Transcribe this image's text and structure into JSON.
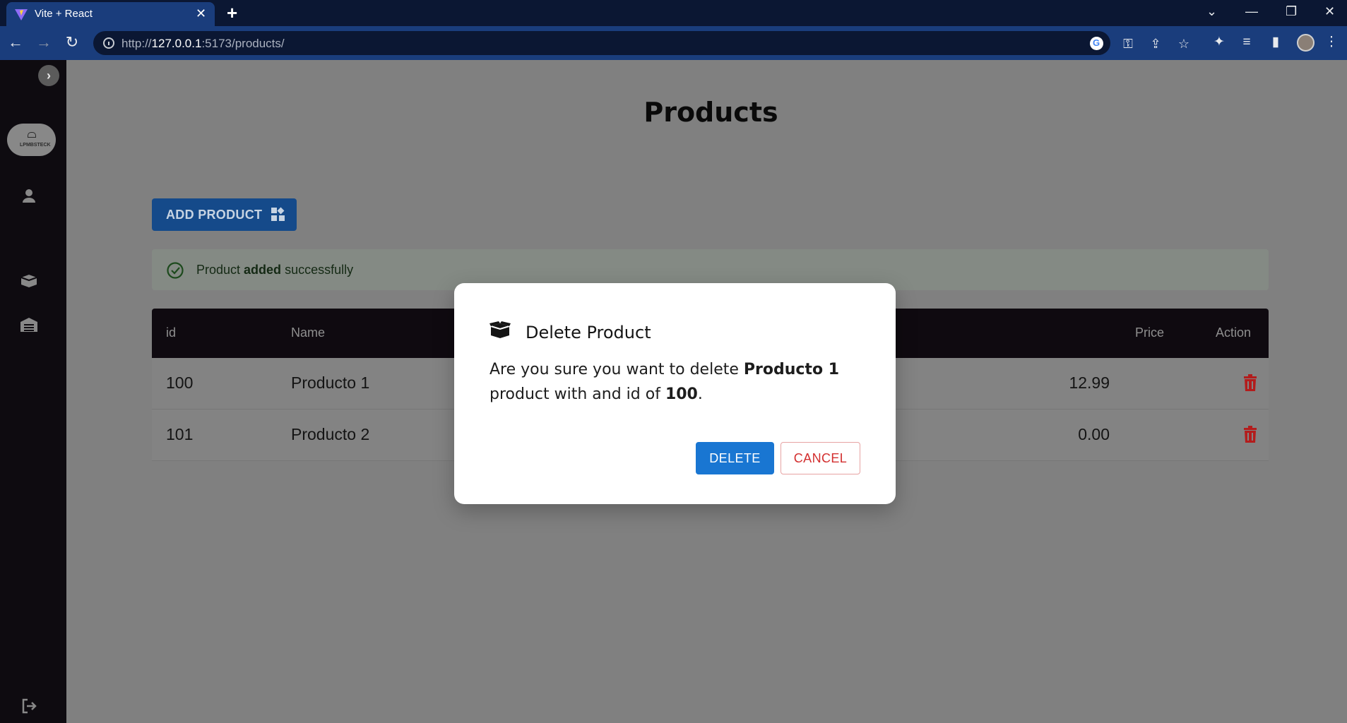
{
  "browser": {
    "tab_title": "Vite + React",
    "new_tab": "+",
    "url_scheme": "http://",
    "url_host": "127.0.0.1",
    "url_path": ":5173/products/"
  },
  "sidebar": {
    "logo_text": "LPMBSTECK",
    "items": [
      {
        "icon": "user-icon"
      },
      {
        "icon": "box-icon"
      },
      {
        "icon": "warehouse-icon"
      },
      {
        "icon": "logout-icon"
      }
    ]
  },
  "page": {
    "title": "Products",
    "add_button_label": "ADD PRODUCT",
    "alert": {
      "prefix": "Product ",
      "bold": "added",
      "suffix": " successfully"
    }
  },
  "table": {
    "headers": {
      "id": "id",
      "name": "Name",
      "price": "Price",
      "action": "Action"
    },
    "rows": [
      {
        "id": "100",
        "name": "Producto 1",
        "price": "12.99"
      },
      {
        "id": "101",
        "name": "Producto 2",
        "price": "0.00"
      }
    ]
  },
  "modal": {
    "title": "Delete Product",
    "body_1": "Are you sure you want to delete ",
    "product_name": "Producto 1",
    "body_2": " product with and id of ",
    "product_id": "100",
    "body_3": ".",
    "delete_label": "DELETE",
    "cancel_label": "CANCEL"
  },
  "colors": {
    "primary": "#1976d2",
    "danger": "#d32f2f",
    "success": "#2e7d32",
    "sidebar": "#0e0b10",
    "browser_frame": "#0b1733"
  }
}
